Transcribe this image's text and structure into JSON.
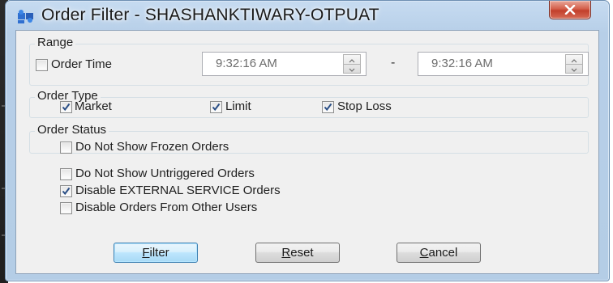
{
  "window": {
    "title": "Order Filter - SHASHANKTIWARY-OTPUAT",
    "close_label": "X"
  },
  "range": {
    "legend": "Range",
    "order_time_label": "Order Time",
    "order_time_checked": false,
    "start_time": "9:32:16 AM",
    "end_time": "9:32:16 AM",
    "separator": "-"
  },
  "order_type": {
    "legend": "Order Type",
    "options": [
      {
        "label": "Market",
        "checked": true
      },
      {
        "label": "Limit",
        "checked": true
      },
      {
        "label": "Stop Loss",
        "checked": true
      }
    ]
  },
  "order_status": {
    "legend": "Order Status",
    "frozen_label": "Do Not Show Frozen Orders",
    "frozen_checked": false
  },
  "options": [
    {
      "label": "Do Not Show Untriggered Orders",
      "checked": false
    },
    {
      "label": "Disable EXTERNAL SERVICE Orders",
      "checked": true
    },
    {
      "label": "Disable Orders From Other Users",
      "checked": false
    }
  ],
  "buttons": {
    "filter": {
      "mnemonic": "F",
      "rest": "ilter"
    },
    "reset": {
      "mnemonic": "R",
      "rest": "eset"
    },
    "cancel": {
      "mnemonic": "C",
      "rest": "ancel"
    }
  },
  "colors": {
    "check": "#2b4f86",
    "title_bar": "#b7cfe8",
    "close_button": "#c9452f",
    "default_button_border": "#3c7fb1"
  }
}
